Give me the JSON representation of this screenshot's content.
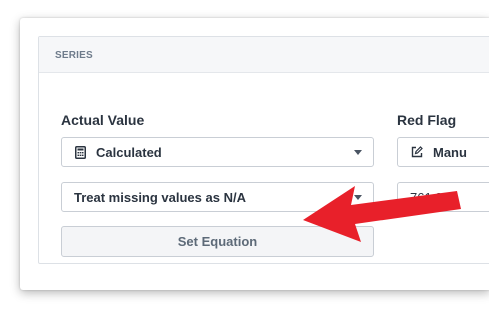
{
  "panel": {
    "header_title": "SERIES"
  },
  "actual_value": {
    "label": "Actual Value",
    "source_select": "Calculated",
    "missing_select": "Treat missing values as N/A",
    "set_equation_button": "Set Equation"
  },
  "red_flag": {
    "label": "Red Flag",
    "source_select": "Manu",
    "value_input": "761,000"
  },
  "colors": {
    "arrow": "#e8202a"
  }
}
